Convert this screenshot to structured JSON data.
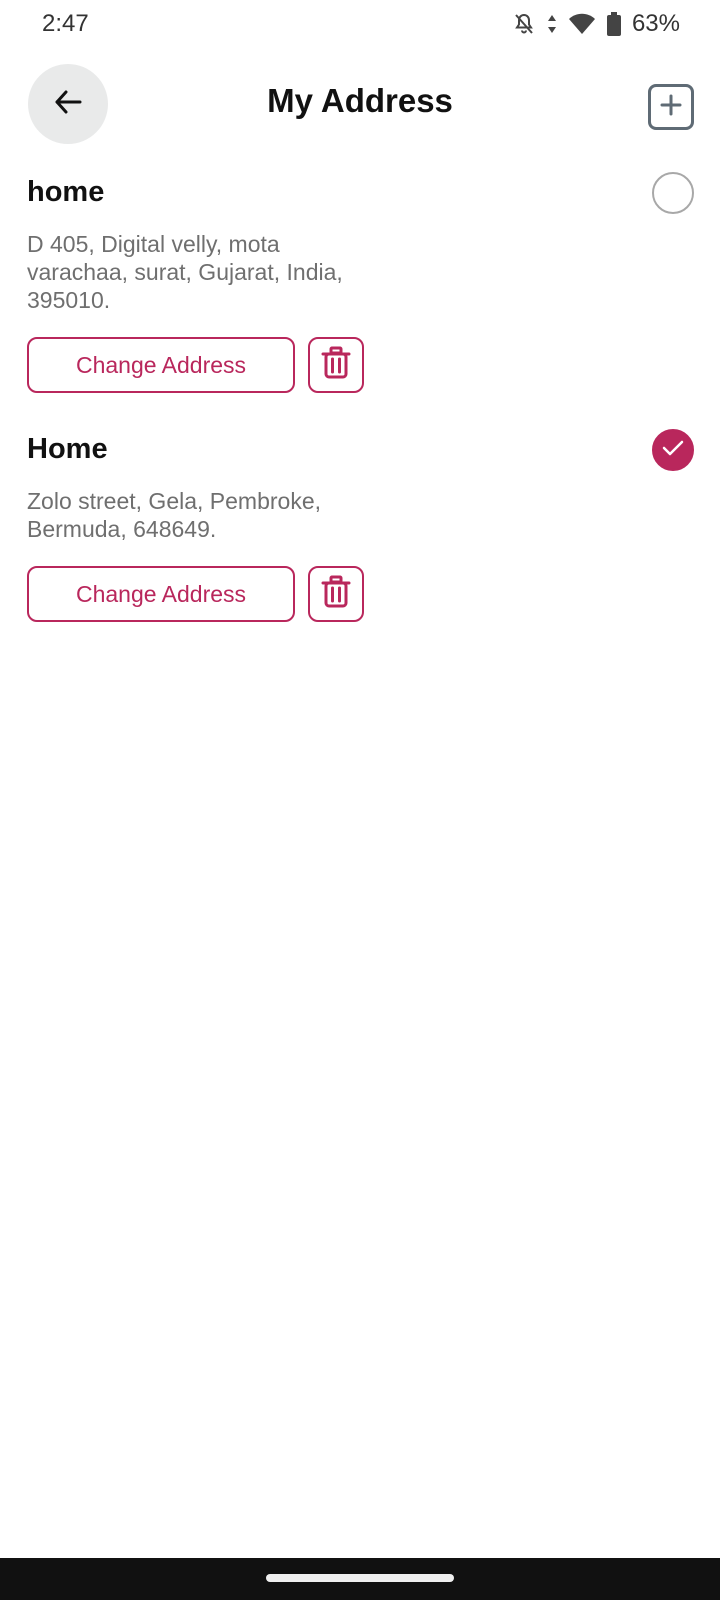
{
  "status_bar": {
    "time": "2:47",
    "battery": "63%",
    "icons": [
      "bell-off-icon",
      "data-arrows-icon",
      "wifi-icon",
      "battery-icon"
    ]
  },
  "header": {
    "title": "My Address",
    "back_icon": "arrow-left-icon",
    "add_icon": "plus-square-icon"
  },
  "colors": {
    "accent": "#b9275c",
    "text_secondary": "#6f6f6f",
    "back_button_bg": "#e9eaea"
  },
  "addresses": [
    {
      "name": "home",
      "address": "D 405, Digital velly, mota varachaa, surat, Gujarat, India, 395010.",
      "change_label": "Change Address",
      "selected": false
    },
    {
      "name": "Home",
      "address": "Zolo street, Gela, Pembroke, Bermuda, 648649.",
      "change_label": "Change Address",
      "selected": true
    }
  ]
}
